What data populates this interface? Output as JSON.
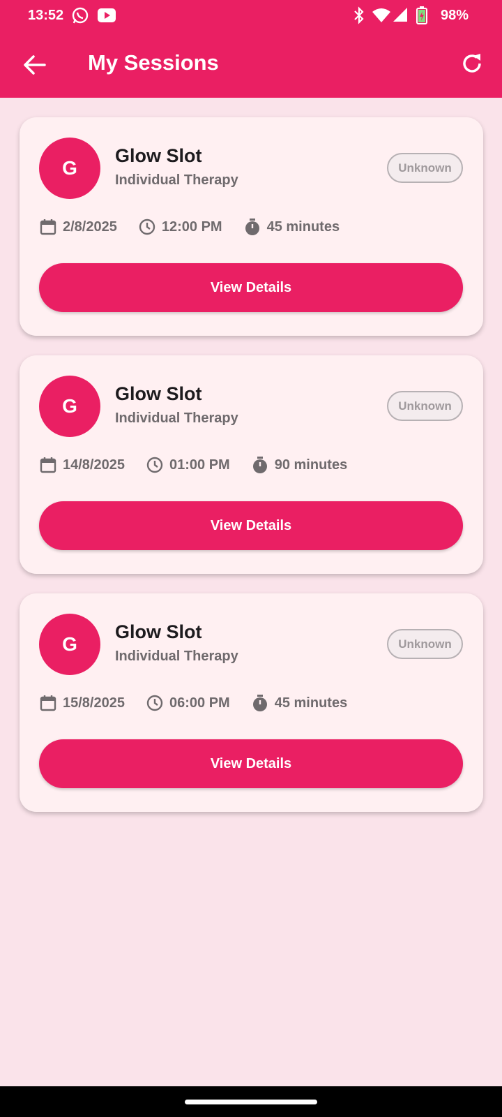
{
  "colors": {
    "primary": "#ea1f63",
    "background": "#fae3ea",
    "card": "#fff0f2"
  },
  "status_bar": {
    "time": "13:52",
    "left_icons": [
      "whatsapp-icon",
      "youtube-icon"
    ],
    "right_icons": [
      "bluetooth-icon",
      "wifi-icon",
      "signal-icon",
      "battery-charging-icon"
    ],
    "battery": "98%"
  },
  "appbar": {
    "title": "My Sessions",
    "back_icon": "arrow-left-icon",
    "refresh_icon": "refresh-icon"
  },
  "sessions": [
    {
      "initial": "G",
      "name": "Glow Slot",
      "type": "Individual Therapy",
      "status": "Unknown",
      "date": "2/8/2025",
      "time": "12:00 PM",
      "duration": "45 minutes",
      "button": "View Details"
    },
    {
      "initial": "G",
      "name": "Glow Slot",
      "type": "Individual Therapy",
      "status": "Unknown",
      "date": "14/8/2025",
      "time": "01:00 PM",
      "duration": "90 minutes",
      "button": "View Details"
    },
    {
      "initial": "G",
      "name": "Glow Slot",
      "type": "Individual Therapy",
      "status": "Unknown",
      "date": "15/8/2025",
      "time": "06:00 PM",
      "duration": "45 minutes",
      "button": "View Details"
    }
  ]
}
